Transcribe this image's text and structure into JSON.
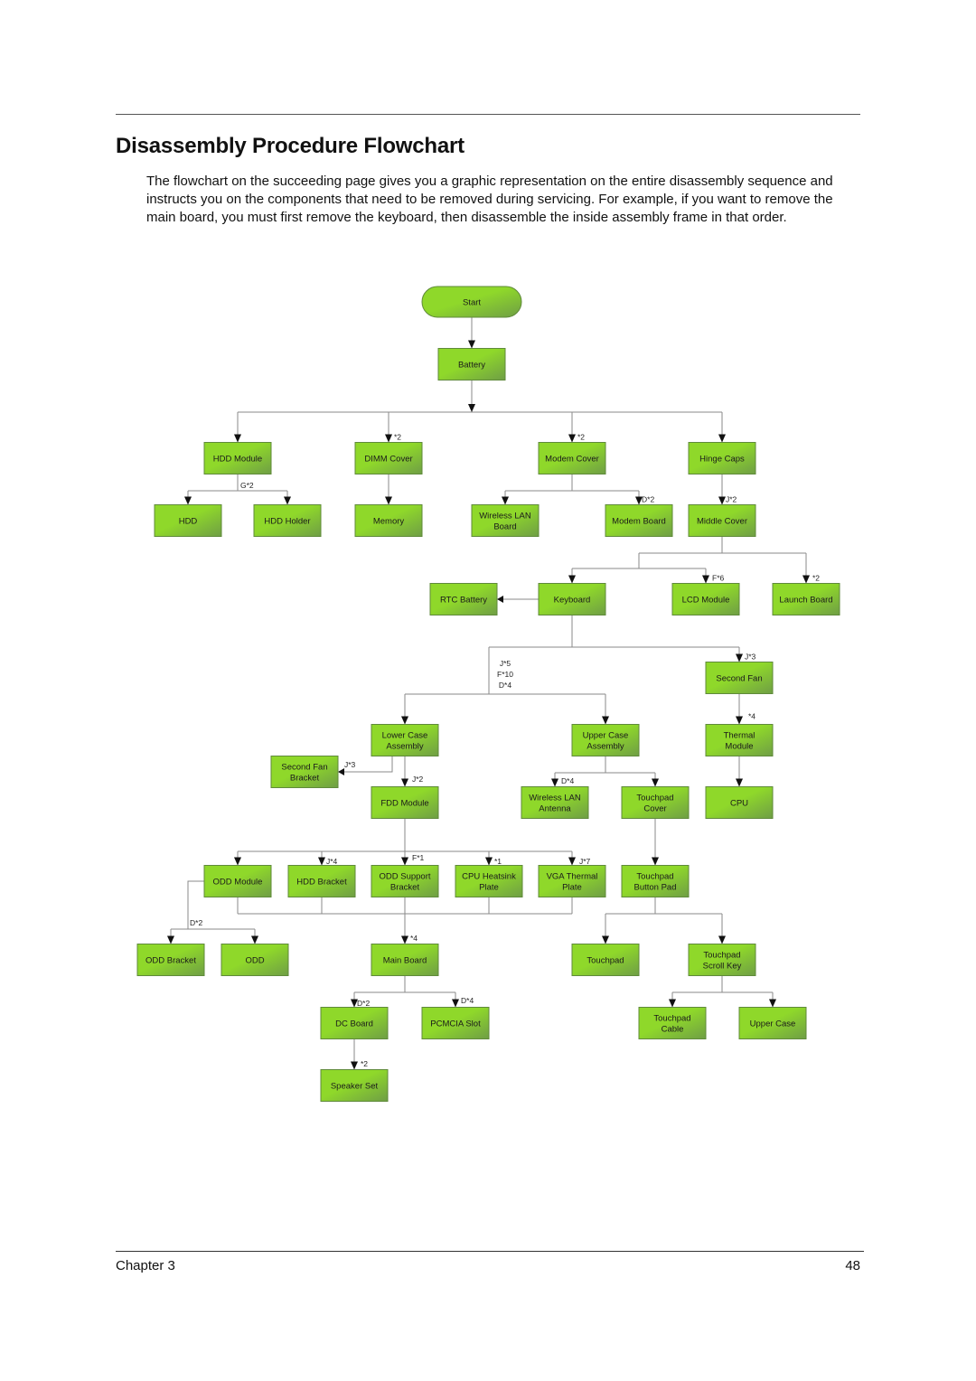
{
  "page": {
    "title": "Disassembly Procedure Flowchart",
    "intro": "The flowchart on the succeeding page gives you a graphic representation on the entire disassembly sequence and instructs you on the components that need to be removed during servicing. For example, if you want to remove the main board, you must first remove the keyboard, then disassemble the inside assembly frame in that order.",
    "footer_left": "Chapter 3",
    "footer_right": "48"
  },
  "colors": {
    "node_fill_top": "#8fd82a",
    "node_fill_bottom": "#6f9e45",
    "node_border": "#5f8a3a",
    "connector": "#8a8a8a",
    "arrow": "#111111"
  },
  "flowchart": {
    "nodes": [
      {
        "id": "start",
        "label": [
          "Start"
        ],
        "shape": "terminator"
      },
      {
        "id": "battery",
        "label": [
          "Battery"
        ]
      },
      {
        "id": "hdd_module",
        "label": [
          "HDD Module"
        ]
      },
      {
        "id": "dimm_cover",
        "label": [
          "DIMM Cover"
        ]
      },
      {
        "id": "modem_cover",
        "label": [
          "Modem Cover"
        ]
      },
      {
        "id": "hinge_caps",
        "label": [
          "Hinge Caps"
        ]
      },
      {
        "id": "hdd",
        "label": [
          "HDD"
        ]
      },
      {
        "id": "hdd_holder",
        "label": [
          "HDD Holder"
        ]
      },
      {
        "id": "memory",
        "label": [
          "Memory"
        ]
      },
      {
        "id": "wireless_lan_board",
        "label": [
          "Wireless LAN",
          "Board"
        ]
      },
      {
        "id": "modem_board",
        "label": [
          "Modem Board"
        ]
      },
      {
        "id": "middle_cover",
        "label": [
          "Middle Cover"
        ]
      },
      {
        "id": "rtc_battery",
        "label": [
          "RTC Battery"
        ]
      },
      {
        "id": "keyboard",
        "label": [
          "Keyboard"
        ]
      },
      {
        "id": "lcd_module",
        "label": [
          "LCD Module"
        ]
      },
      {
        "id": "launch_board",
        "label": [
          "Launch Board"
        ]
      },
      {
        "id": "second_fan",
        "label": [
          "Second Fan"
        ]
      },
      {
        "id": "lower_case_assembly",
        "label": [
          "Lower Case",
          "Assembly"
        ]
      },
      {
        "id": "upper_case_assembly",
        "label": [
          "Upper Case",
          "Assembly"
        ]
      },
      {
        "id": "thermal_module",
        "label": [
          "Thermal",
          "Module"
        ]
      },
      {
        "id": "second_fan_bracket",
        "label": [
          "Second Fan",
          "Bracket"
        ]
      },
      {
        "id": "fdd_module",
        "label": [
          "FDD Module"
        ]
      },
      {
        "id": "wireless_lan_antenna",
        "label": [
          "Wireless LAN",
          "Antenna"
        ]
      },
      {
        "id": "touchpad_cover",
        "label": [
          "Touchpad",
          "Cover"
        ]
      },
      {
        "id": "cpu",
        "label": [
          "CPU"
        ]
      },
      {
        "id": "odd_module",
        "label": [
          "ODD Module"
        ]
      },
      {
        "id": "hdd_bracket",
        "label": [
          "HDD Bracket"
        ]
      },
      {
        "id": "odd_support_bracket",
        "label": [
          "ODD Support",
          "Bracket"
        ]
      },
      {
        "id": "cpu_heatsink_plate",
        "label": [
          "CPU Heatsink",
          "Plate"
        ]
      },
      {
        "id": "vga_thermal_plate",
        "label": [
          "VGA Thermal",
          "Plate"
        ]
      },
      {
        "id": "touchpad_button_pad",
        "label": [
          "Touchpad",
          "Button Pad"
        ]
      },
      {
        "id": "odd_bracket",
        "label": [
          "ODD Bracket"
        ]
      },
      {
        "id": "odd",
        "label": [
          "ODD"
        ]
      },
      {
        "id": "main_board",
        "label": [
          "Main Board"
        ]
      },
      {
        "id": "touchpad",
        "label": [
          "Touchpad"
        ]
      },
      {
        "id": "touchpad_scroll_key",
        "label": [
          "Touchpad",
          "Scroll Key"
        ]
      },
      {
        "id": "dc_board",
        "label": [
          "DC Board"
        ]
      },
      {
        "id": "pcmcia_slot",
        "label": [
          "PCMCIA Slot"
        ]
      },
      {
        "id": "touchpad_cable",
        "label": [
          "Touchpad",
          "Cable"
        ]
      },
      {
        "id": "upper_case",
        "label": [
          "Upper Case"
        ]
      },
      {
        "id": "speaker_set",
        "label": [
          "Speaker Set"
        ]
      }
    ],
    "edges": [
      {
        "from": "start",
        "to": "battery",
        "label": ""
      },
      {
        "from": "battery",
        "to": "hdd_module",
        "label": ""
      },
      {
        "from": "battery",
        "to": "dimm_cover",
        "label": "*2"
      },
      {
        "from": "battery",
        "to": "modem_cover",
        "label": "*2"
      },
      {
        "from": "battery",
        "to": "hinge_caps",
        "label": ""
      },
      {
        "from": "hdd_module",
        "to": "hdd",
        "label": "G*2"
      },
      {
        "from": "hdd_module",
        "to": "hdd_holder",
        "label": ""
      },
      {
        "from": "dimm_cover",
        "to": "memory",
        "label": ""
      },
      {
        "from": "modem_cover",
        "to": "wireless_lan_board",
        "label": ""
      },
      {
        "from": "modem_cover",
        "to": "modem_board",
        "label": "D*2"
      },
      {
        "from": "hinge_caps",
        "to": "middle_cover",
        "label": "J*2"
      },
      {
        "from": "middle_cover",
        "to": "keyboard",
        "label": ""
      },
      {
        "from": "middle_cover",
        "to": "lcd_module",
        "label": "F*6"
      },
      {
        "from": "middle_cover",
        "to": "launch_board",
        "label": "*2"
      },
      {
        "from": "keyboard",
        "to": "rtc_battery",
        "label": ""
      },
      {
        "from": "keyboard",
        "to": "lower_case_assembly",
        "label": "J*5 F*10 D*4"
      },
      {
        "from": "keyboard",
        "to": "upper_case_assembly",
        "label": ""
      },
      {
        "from": "keyboard",
        "to": "second_fan",
        "label": "J*3"
      },
      {
        "from": "second_fan",
        "to": "thermal_module",
        "label": "*4"
      },
      {
        "from": "thermal_module",
        "to": "cpu",
        "label": ""
      },
      {
        "from": "lower_case_assembly",
        "to": "second_fan_bracket",
        "label": "J*3"
      },
      {
        "from": "lower_case_assembly",
        "to": "fdd_module",
        "label": "J*2"
      },
      {
        "from": "upper_case_assembly",
        "to": "wireless_lan_antenna",
        "label": "D*4"
      },
      {
        "from": "upper_case_assembly",
        "to": "touchpad_cover",
        "label": ""
      },
      {
        "from": "touchpad_cover",
        "to": "touchpad_button_pad",
        "label": ""
      },
      {
        "from": "fdd_module",
        "to": "odd_module",
        "label": ""
      },
      {
        "from": "fdd_module",
        "to": "hdd_bracket",
        "label": "J*4"
      },
      {
        "from": "fdd_module",
        "to": "odd_support_bracket",
        "label": "F*1"
      },
      {
        "from": "fdd_module",
        "to": "cpu_heatsink_plate",
        "label": "*1"
      },
      {
        "from": "fdd_module",
        "to": "vga_thermal_plate",
        "label": "J*7"
      },
      {
        "from": "odd_module",
        "to": "odd_bracket",
        "label": "D*2"
      },
      {
        "from": "odd_module",
        "to": "odd",
        "label": ""
      },
      {
        "from": "odd_support_bracket",
        "to": "main_board",
        "label": "*4"
      },
      {
        "from": "touchpad_button_pad",
        "to": "touchpad",
        "label": ""
      },
      {
        "from": "touchpad_button_pad",
        "to": "touchpad_scroll_key",
        "label": ""
      },
      {
        "from": "touchpad_scroll_key",
        "to": "touchpad_cable",
        "label": ""
      },
      {
        "from": "touchpad_scroll_key",
        "to": "upper_case",
        "label": ""
      },
      {
        "from": "main_board",
        "to": "dc_board",
        "label": "D*2"
      },
      {
        "from": "main_board",
        "to": "pcmcia_slot",
        "label": "D*4"
      },
      {
        "from": "dc_board",
        "to": "speaker_set",
        "label": "*2"
      }
    ]
  }
}
